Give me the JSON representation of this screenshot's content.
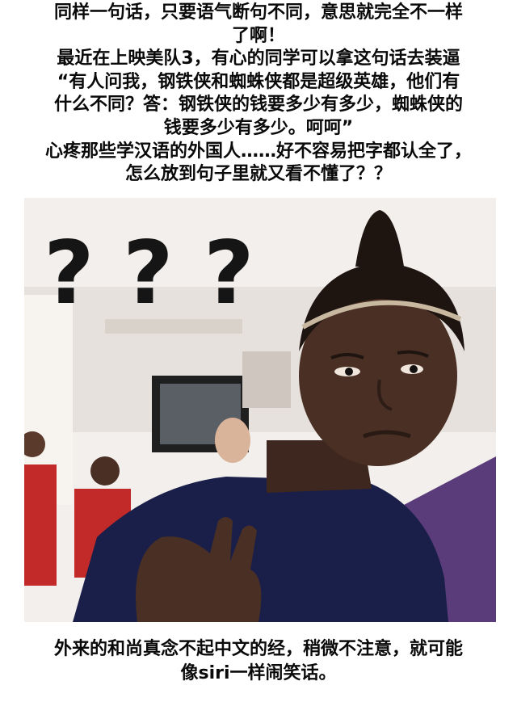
{
  "caption_top": {
    "lines": [
      "同样一句话，只要语气断句不同，意思就完全不一样",
      "了啊！",
      "最近在上映美队3，有心的同学可以拿这句话去装逼",
      "“有人问我，钢铁侠和蜘蛛侠都是超级英雄，他们有",
      "什么不同？答：钢铁侠的钱要多少有多少，蜘蛛侠的",
      "钱要多少有多少。呵呵”",
      "心疼那些学汉语的外国人……好不容易把字都认全了，",
      "怎么放到句子里就又看不懂了？？"
    ]
  },
  "meme_image": {
    "question_marks": [
      "?",
      "?",
      "?"
    ],
    "colors": {
      "background_wall": "#f2efec",
      "window_frame": "#1f1f1f",
      "shirt": "#1a1f4a",
      "skin": "#4a2f24",
      "red_shirt": "#c22a2a",
      "purple_right": "#5b3c7a"
    }
  },
  "caption_bottom": {
    "lines": [
      "外来的和尚真念不起中文的经，稍微不注意，就可能",
      "像siri一样闹笑话。"
    ]
  }
}
